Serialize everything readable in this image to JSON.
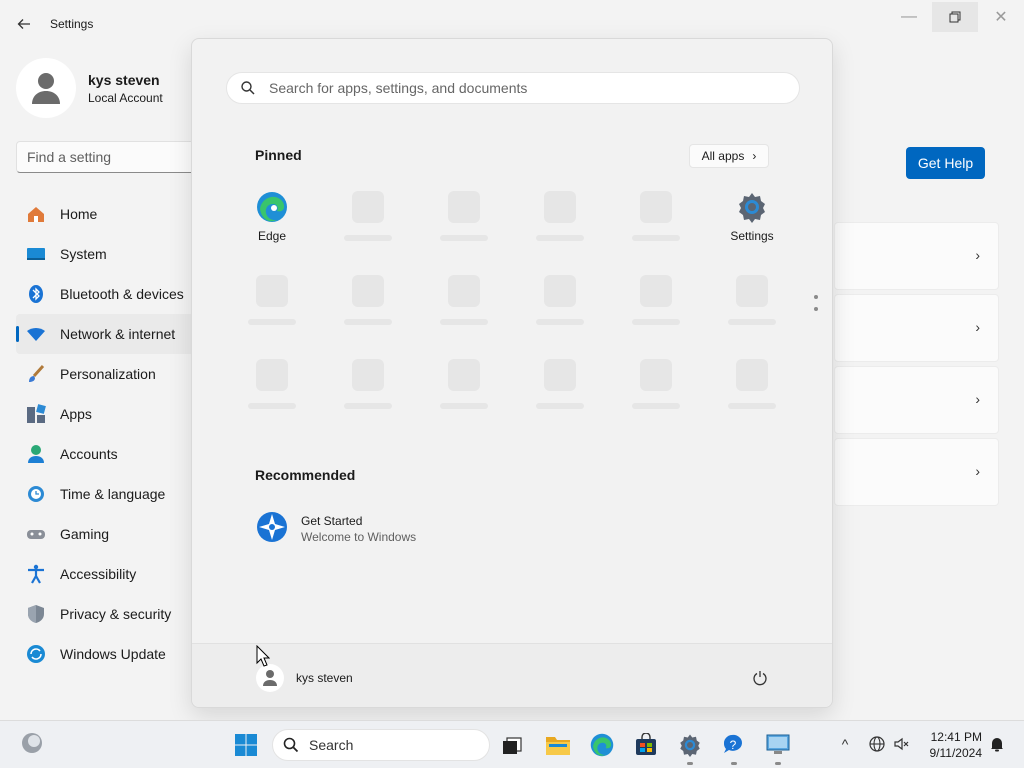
{
  "window": {
    "title": "Settings",
    "minimize_glyph": "—",
    "maximize_glyph": "❐",
    "close_glyph": "✕"
  },
  "profile": {
    "name": "kys steven",
    "account_type": "Local Account"
  },
  "find_setting": {
    "placeholder": "Find a setting"
  },
  "nav": {
    "items": [
      {
        "label": "Home",
        "icon": "home-icon"
      },
      {
        "label": "System",
        "icon": "system-icon"
      },
      {
        "label": "Bluetooth & devices",
        "icon": "bluetooth-icon"
      },
      {
        "label": "Network & internet",
        "icon": "wifi-icon",
        "active": true
      },
      {
        "label": "Personalization",
        "icon": "brush-icon"
      },
      {
        "label": "Apps",
        "icon": "apps-icon"
      },
      {
        "label": "Accounts",
        "icon": "accounts-icon"
      },
      {
        "label": "Time & language",
        "icon": "clock-globe-icon"
      },
      {
        "label": "Gaming",
        "icon": "gamepad-icon"
      },
      {
        "label": "Accessibility",
        "icon": "accessibility-icon"
      },
      {
        "label": "Privacy & security",
        "icon": "shield-icon"
      },
      {
        "label": "Windows Update",
        "icon": "update-icon"
      }
    ]
  },
  "main": {
    "get_help_label": "Get Help",
    "chevron_glyph": "›"
  },
  "start_menu": {
    "search_placeholder": "Search for apps, settings, and documents",
    "pinned_title": "Pinned",
    "all_apps_label": "All apps",
    "all_apps_chevron": "›",
    "pinned_apps": [
      {
        "label": "Edge",
        "icon": "edge-icon"
      },
      {
        "label": "Settings",
        "icon": "settings-gear-icon"
      }
    ],
    "recommended_title": "Recommended",
    "recommended": [
      {
        "title": "Get Started",
        "subtitle": "Welcome to Windows",
        "icon": "get-started-icon"
      }
    ],
    "user_name": "kys steven"
  },
  "taskbar": {
    "search_label": "Search",
    "time": "12:41 PM",
    "date": "9/11/2024",
    "overflow_glyph": "^"
  },
  "colors": {
    "accent": "#0067c0",
    "background": "#f3f3f3",
    "start_bg": "#f2f2f2"
  }
}
